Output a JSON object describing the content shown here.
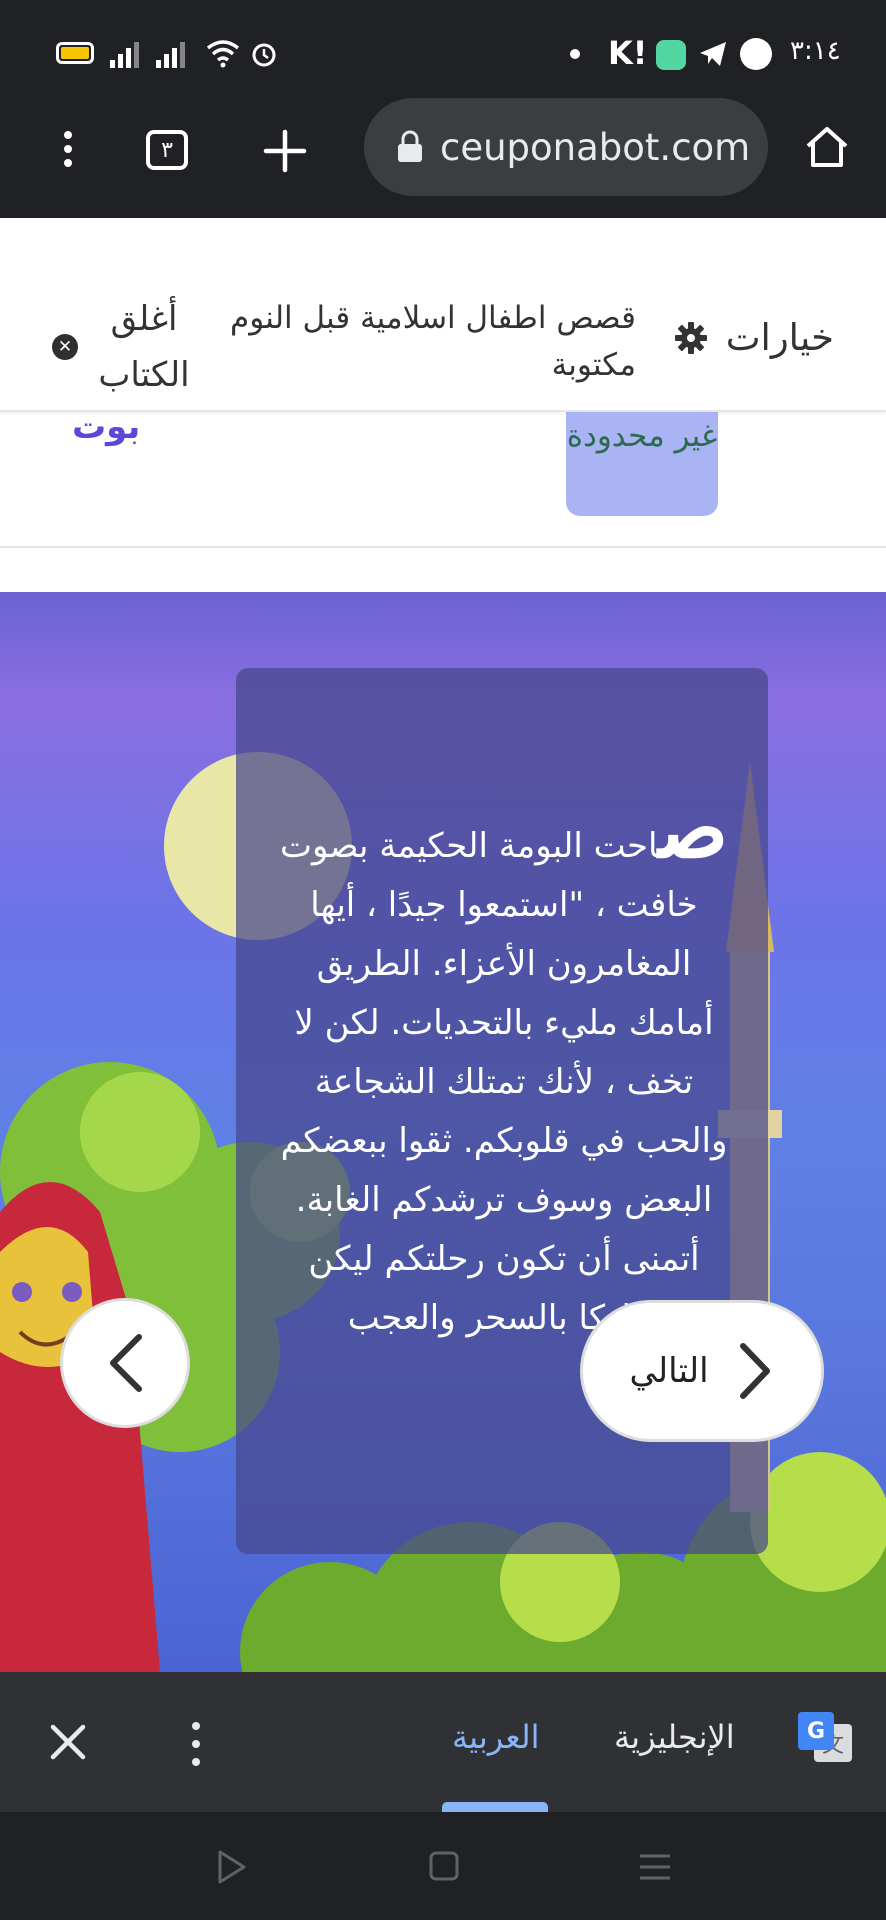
{
  "status_bar": {
    "time": "٣:١٤",
    "icons": [
      "battery-icon",
      "signal-icon",
      "signal-icon",
      "wifi-icon",
      "alarm-icon",
      "dot-icon",
      "k-app-icon",
      "app-icon",
      "telegram-icon",
      "app-icon"
    ]
  },
  "browser": {
    "tab_count": "٣",
    "url": "ceuponabot.com"
  },
  "header": {
    "options_label": "خيارات",
    "title": "قصص اطفال اسلامية قبل النوم مكتوبة",
    "close_label": "أغلق الكتاب"
  },
  "stripe": {
    "badge": "غير محدودة",
    "link": "بوت"
  },
  "story": {
    "drop_cap": "ص",
    "text": "احت البومة الحكيمة بصوت خافت ، \"استمعوا جيدًا ، أيها المغامرون الأعزاء. الطريق أمامك مليء بالتحديات. لكن لا تخف ، لأنك تمتلك الشجاعة والحب في قلوبكم. ثقوا ببعضكم البعض وسوف ترشدكم الغابة. أتمنى أن تكون رحلتكم ليكن مباركا بالسحر والعجب",
    "next_label": "التالي"
  },
  "translate": {
    "lang_en": "الإنجليزية",
    "lang_ar": "العربية",
    "active": "العربية",
    "accent": "#8ab4f8"
  }
}
